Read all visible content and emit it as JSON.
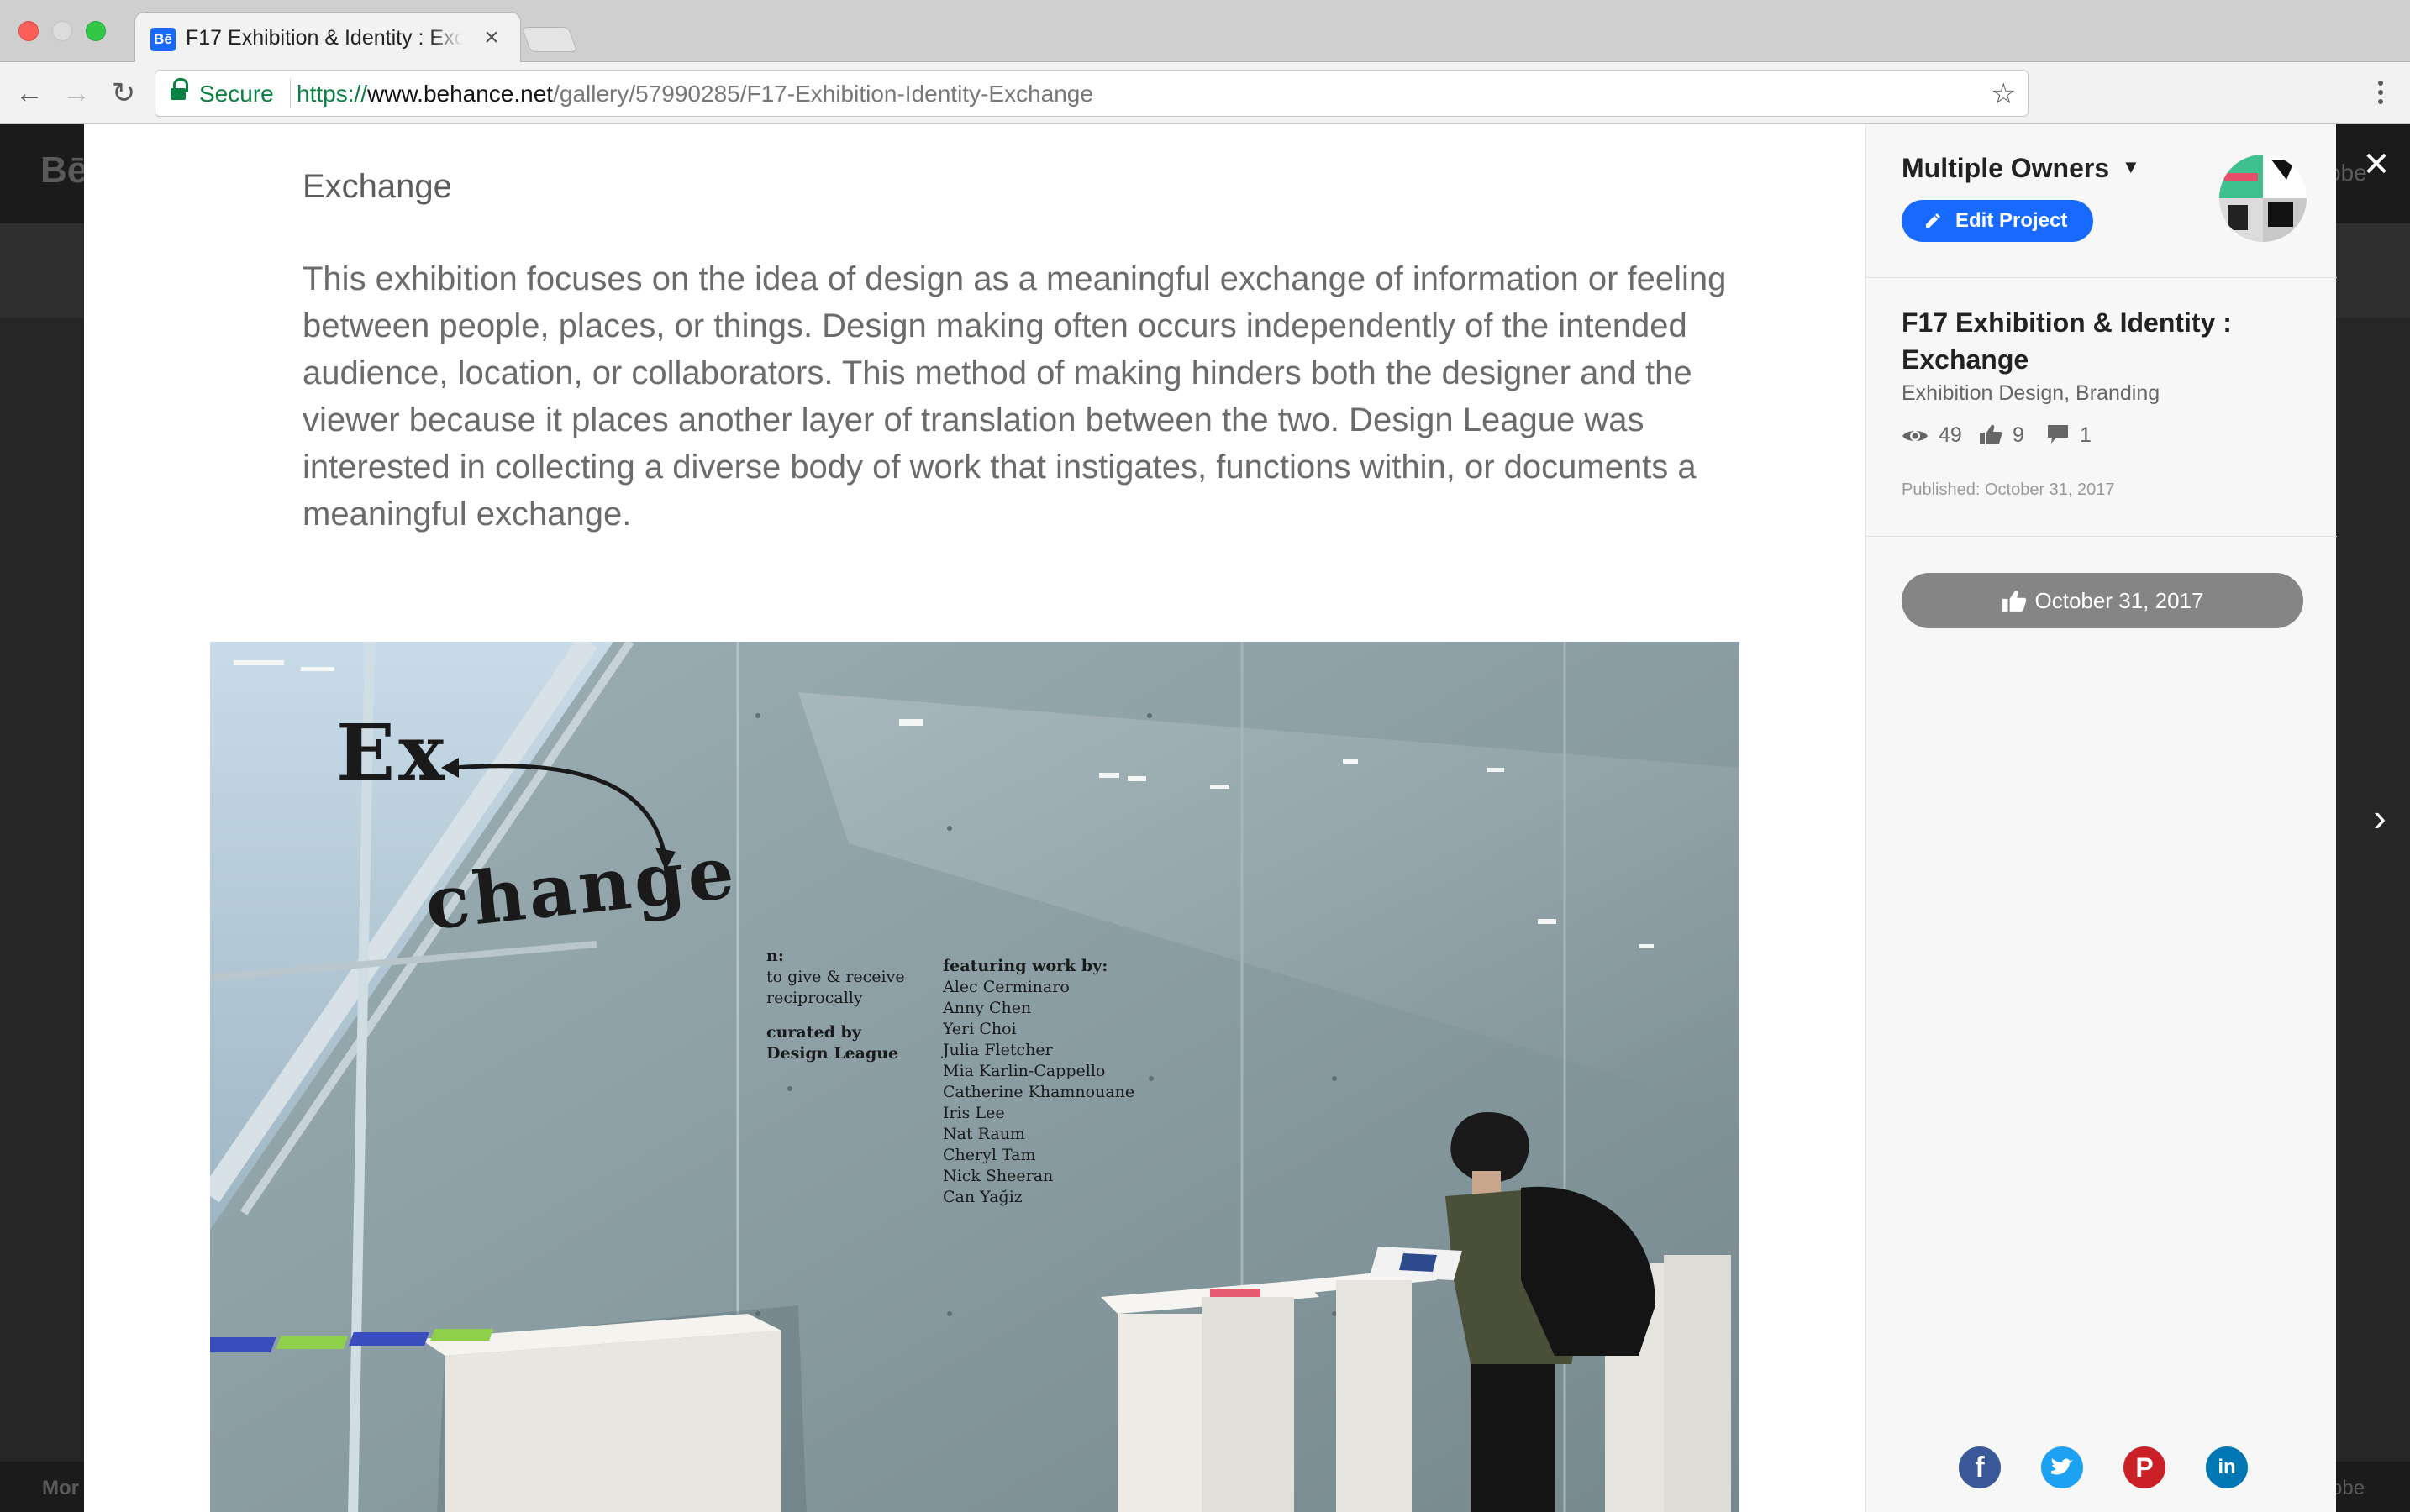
{
  "browser": {
    "tab_title": "F17 Exhibition & Identity : Exchange",
    "favicon_text": "Bē",
    "tab_close": "×",
    "secure_label": "Secure",
    "url_scheme": "https://",
    "url_host": "www.behance.net",
    "url_path": "/gallery/57990285/F17-Exhibition-Identity-Exchange"
  },
  "backdrop": {
    "logo": "Bē",
    "adobe_top": "obe",
    "more": "Mor",
    "adobe_bottom": "obe"
  },
  "project": {
    "section_heading": "Exchange",
    "description": "This exhibition focuses on the idea of design as a meaningful exchange of information or feeling between people, places, or things. Design making often occurs independently of the intended audience, location, or collaborators. This method of making hinders both the designer and the viewer because it places another layer of translation between the two. Design League was interested in collecting a diverse body of work that instigates, functions within, or documents a meaningful exchange.",
    "photo": {
      "word_ex": "Ex",
      "word_change": "change",
      "definition_label": "n:",
      "definition_1": "to give & receive",
      "definition_2": "reciprocally",
      "curated_1": "curated by",
      "curated_2": "Design League",
      "featuring": "featuring work by:",
      "names": [
        "Alec Cerminaro",
        "Anny Chen",
        "Yeri Choi",
        "Julia Fletcher",
        "Mia Karlin-Cappello",
        "Catherine Khamnouane",
        "Iris Lee",
        "Nat Raum",
        "Cheryl Tam",
        "Nick Sheeran",
        "Can Yağiz"
      ]
    }
  },
  "sidebar": {
    "owner_label": "Multiple Owners",
    "edit_button": "Edit Project",
    "title": "F17 Exhibition & Identity : Exchange",
    "fields": "Exhibition Design, Branding",
    "views": "49",
    "appreciations": "9",
    "comments": "1",
    "published": "Published: October 31, 2017",
    "appreciate_date": "October 31, 2017",
    "share": [
      "facebook-icon",
      "twitter-icon",
      "pinterest-icon",
      "linkedin-icon"
    ]
  },
  "colors": {
    "accent": "#1769ff",
    "secure": "#0b8043",
    "facebook": "#3b5998",
    "twitter": "#1da1f2",
    "pinterest": "#cb2027",
    "linkedin": "#0077b5"
  }
}
